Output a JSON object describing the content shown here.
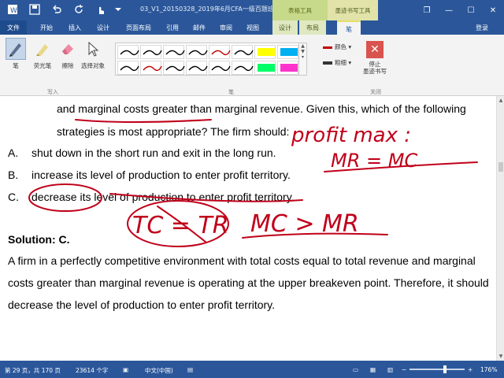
{
  "titlebar": {
    "doc_title": "03_V1_20150328_2019年6月CFA一级百题班...",
    "context_group_1": "表格工具",
    "context_group_2": "墨迹书写工具",
    "window_buttons": {
      "restore": "❐",
      "minimize": "—",
      "maximize": "☐",
      "close": "✕"
    }
  },
  "tabs": {
    "file": "文件",
    "items": [
      "开始",
      "插入",
      "设计",
      "页面布局",
      "引用",
      "邮件",
      "审阅",
      "视图",
      "设计",
      "布局",
      "笔"
    ],
    "sign_in": "登录"
  },
  "ribbon": {
    "tools": [
      {
        "label": "笔",
        "icon": "pen-icon"
      },
      {
        "label": "荧光笔",
        "icon": "highlighter-icon"
      },
      {
        "label": "擦除",
        "icon": "eraser-icon"
      },
      {
        "label": "选择对象",
        "icon": "select-arrow-icon"
      }
    ],
    "pen_colors": [
      "#000000",
      "#000000",
      "#000000",
      "#000000",
      "#c00000",
      "#000000",
      "#ffff00",
      "#00b0f0",
      "#000000",
      "#c00000",
      "#000000",
      "#000000",
      "#000000",
      "#000000",
      "#00ff66",
      "#ff33cc"
    ],
    "color_label": "颜色",
    "weight_label": "粗细",
    "stop_label_line1": "停止",
    "stop_label_line2": "墨迹书写",
    "group_labels": {
      "write": "写入",
      "pens": "笔",
      "close": "关闭"
    }
  },
  "document": {
    "lines": {
      "l1": "and marginal costs greater than marginal revenue. Given this, which of the following",
      "l2": "strategies is most appropriate? The firm should:",
      "optA_letter": "A.",
      "optA": "shut down in the short run and exit in the long run.",
      "optB_letter": "B.",
      "optB": "increase its level of production to enter profit territory.",
      "optC_letter": "C.",
      "optC": "decrease its level of production to enter profit territory.",
      "solution": "Solution: C.",
      "p1": "A firm in a perfectly competitive environment with total costs equal to total revenue and marginal",
      "p2": "costs greater than marginal revenue is operating at the upper breakeven point. Therefore, it should",
      "p3": "decrease the level of production to enter profit territory."
    },
    "handwriting": {
      "profit_max": "profit max :",
      "mr_mc": "MR = MC",
      "tc_tr": "TC = TR",
      "mc_mr": "MC > MR"
    },
    "ink_color": "#c0001a"
  },
  "statusbar": {
    "page": "第 29 页，共 170 页",
    "words": "23614 个字",
    "lang": "中文(中国)",
    "zoom_minus": "−",
    "zoom_plus": "+",
    "zoom": "176%"
  }
}
